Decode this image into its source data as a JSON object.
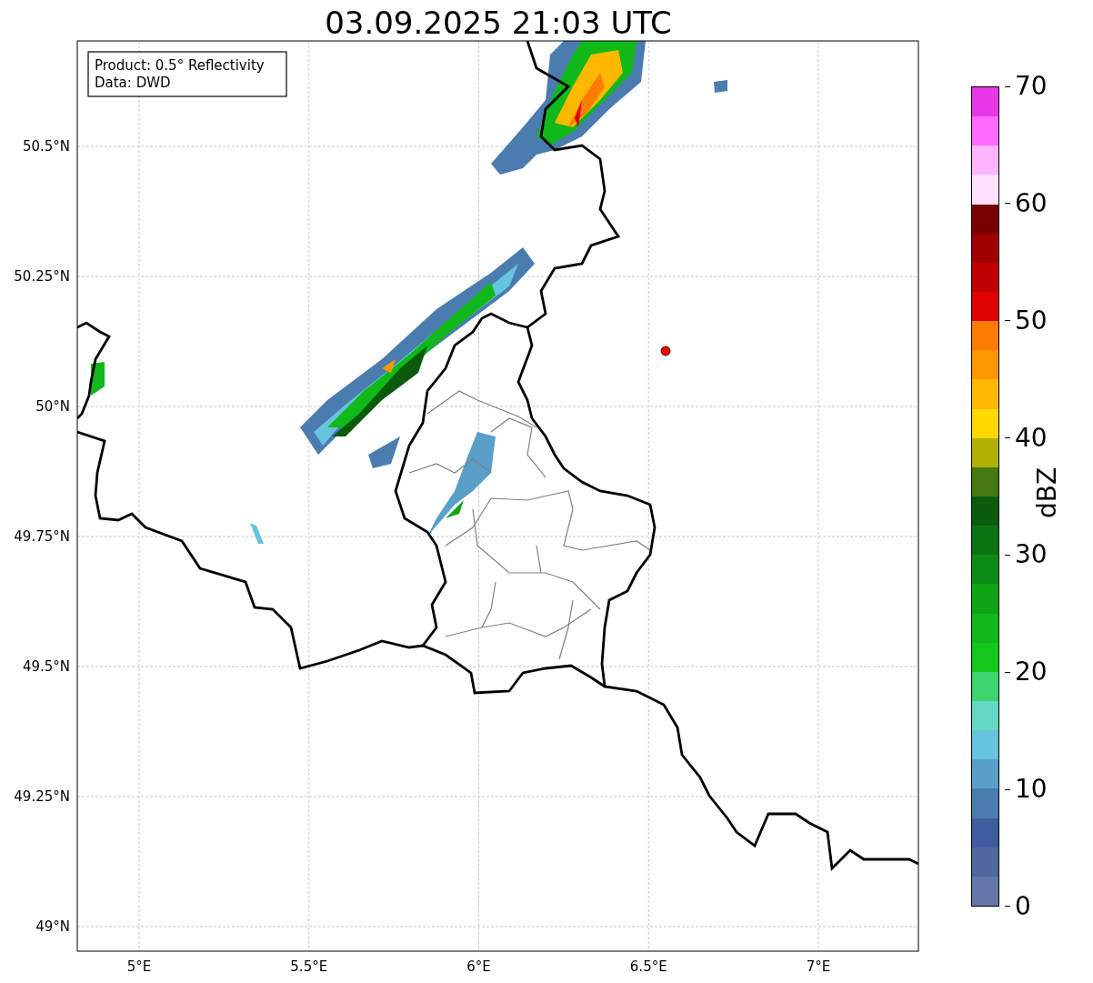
{
  "title": "03.09.2025 21:03 UTC",
  "info_box": [
    "Product: 0.5° Reflectivity",
    "Data: DWD"
  ],
  "map": {
    "lat_ticks": [
      "50.5°N",
      "50.25°N",
      "50°N",
      "49.75°N",
      "49.5°N",
      "49.25°N",
      "49°N"
    ],
    "lon_ticks": [
      "5°E",
      "5.5°E",
      "6°E",
      "6.5°E",
      "7°E"
    ]
  },
  "colorbar": {
    "label": "dBZ",
    "ticks": [
      "70",
      "60",
      "50",
      "40",
      "30",
      "20",
      "10",
      "0"
    ],
    "steps": [
      {
        "color": "#6577a8"
      },
      {
        "color": "#4f68a0"
      },
      {
        "color": "#405da0"
      },
      {
        "color": "#4a7cb0"
      },
      {
        "color": "#5a9fc8"
      },
      {
        "color": "#66c4dc"
      },
      {
        "color": "#64d8c4"
      },
      {
        "color": "#3cd46c"
      },
      {
        "color": "#12c81a"
      },
      {
        "color": "#10b81a"
      },
      {
        "color": "#0ea414"
      },
      {
        "color": "#0c8c14"
      },
      {
        "color": "#0a7410"
      },
      {
        "color": "#0a5c0c"
      },
      {
        "color": "#467810"
      },
      {
        "color": "#b0b000"
      },
      {
        "color": "#ffd800"
      },
      {
        "color": "#ffb800"
      },
      {
        "color": "#ff9800"
      },
      {
        "color": "#ff7c00"
      },
      {
        "color": "#e00000"
      },
      {
        "color": "#c00000"
      },
      {
        "color": "#a00000"
      },
      {
        "color": "#780000"
      },
      {
        "color": "#ffe0ff"
      },
      {
        "color": "#ffb4ff"
      },
      {
        "color": "#ff6cff"
      },
      {
        "color": "#e838e8"
      }
    ]
  }
}
